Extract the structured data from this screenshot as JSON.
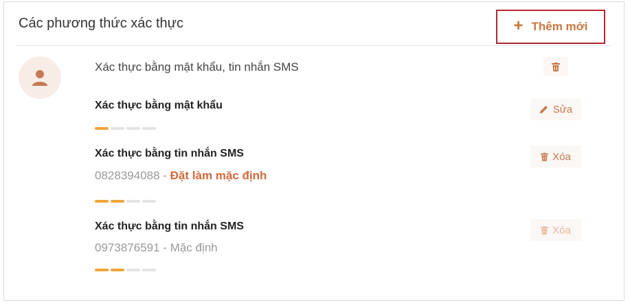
{
  "panel": {
    "title": "Các phương thức xác thực",
    "add_button": {
      "icon": "plus-icon",
      "label": "Thêm mới"
    }
  },
  "summary": {
    "avatar_icon": "user-icon",
    "text": "Xác thực bằng mật khẩu, tin nhắn SMS",
    "delete_icon": "trash-icon"
  },
  "methods": [
    {
      "title": "Xác thực bằng mật khẩu",
      "action": {
        "icon": "pencil-icon",
        "label": "Sửa"
      },
      "strength": {
        "filled": 1,
        "total": 4
      }
    },
    {
      "title": "Xác thực bằng tin nhắn SMS",
      "phone": "0828394088",
      "separator": " - ",
      "status": "Đặt làm mặc định",
      "action": {
        "icon": "trash-icon",
        "label": "Xóa"
      },
      "strength": {
        "filled": 2,
        "total": 4
      }
    },
    {
      "title": "Xác thực bằng tin nhắn SMS",
      "phone": "0973876591",
      "separator": " - ",
      "status": "Mặc định",
      "action": {
        "icon": "trash-icon",
        "label": "Xóa",
        "disabled": true
      },
      "strength": {
        "filled": 2,
        "total": 4
      }
    }
  ],
  "colors": {
    "accent": "#d3693a",
    "highlight_border": "#b3262e",
    "strength_on": "#f0a43a",
    "strength_off": "#e3e3e3"
  }
}
